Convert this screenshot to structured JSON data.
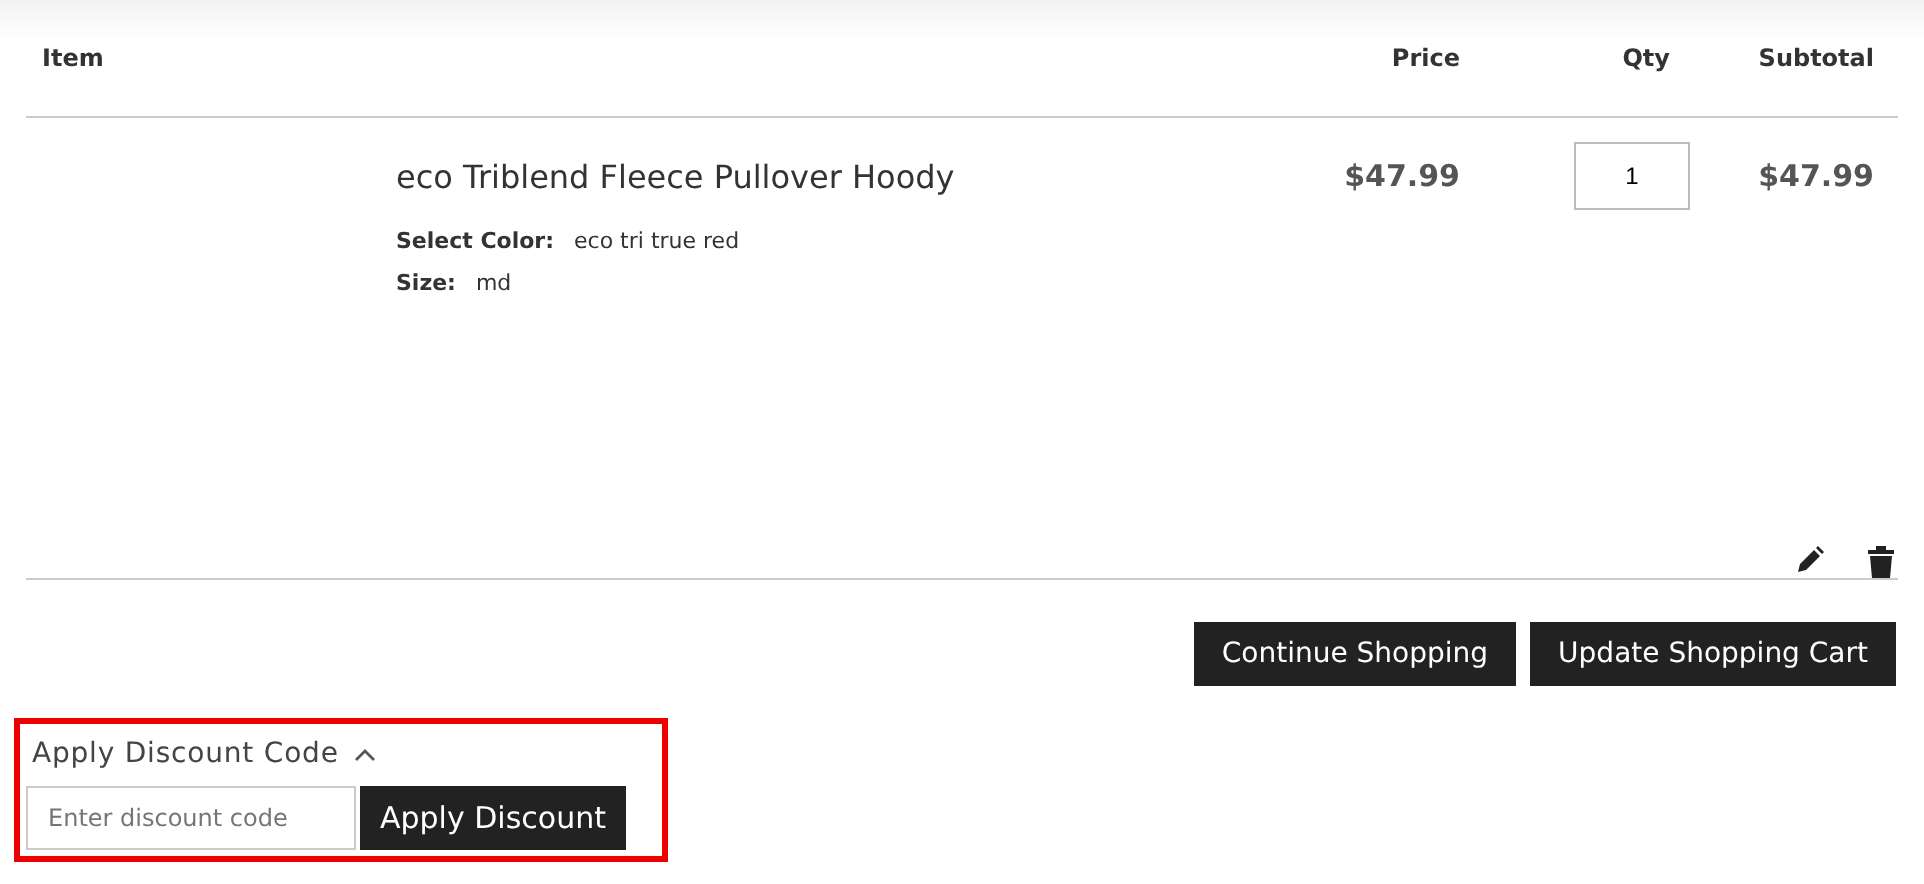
{
  "table": {
    "columns": [
      "Item",
      "Price",
      "Qty",
      "Subtotal"
    ],
    "rows": [
      {
        "name": "eco Triblend Fleece Pullover Hoody",
        "options": [
          {
            "label": "Select Color:",
            "value": "eco tri true red"
          },
          {
            "label": "Size:",
            "value": "md"
          }
        ],
        "price": "$47.99",
        "qty": "1",
        "subtotal": "$47.99"
      }
    ]
  },
  "actions": [
    "Continue Shopping",
    "Update Shopping Cart"
  ],
  "discount": {
    "title": "Apply Discount Code",
    "expanded": true,
    "placeholder": "Enter discount code",
    "button": "Apply Discount"
  }
}
